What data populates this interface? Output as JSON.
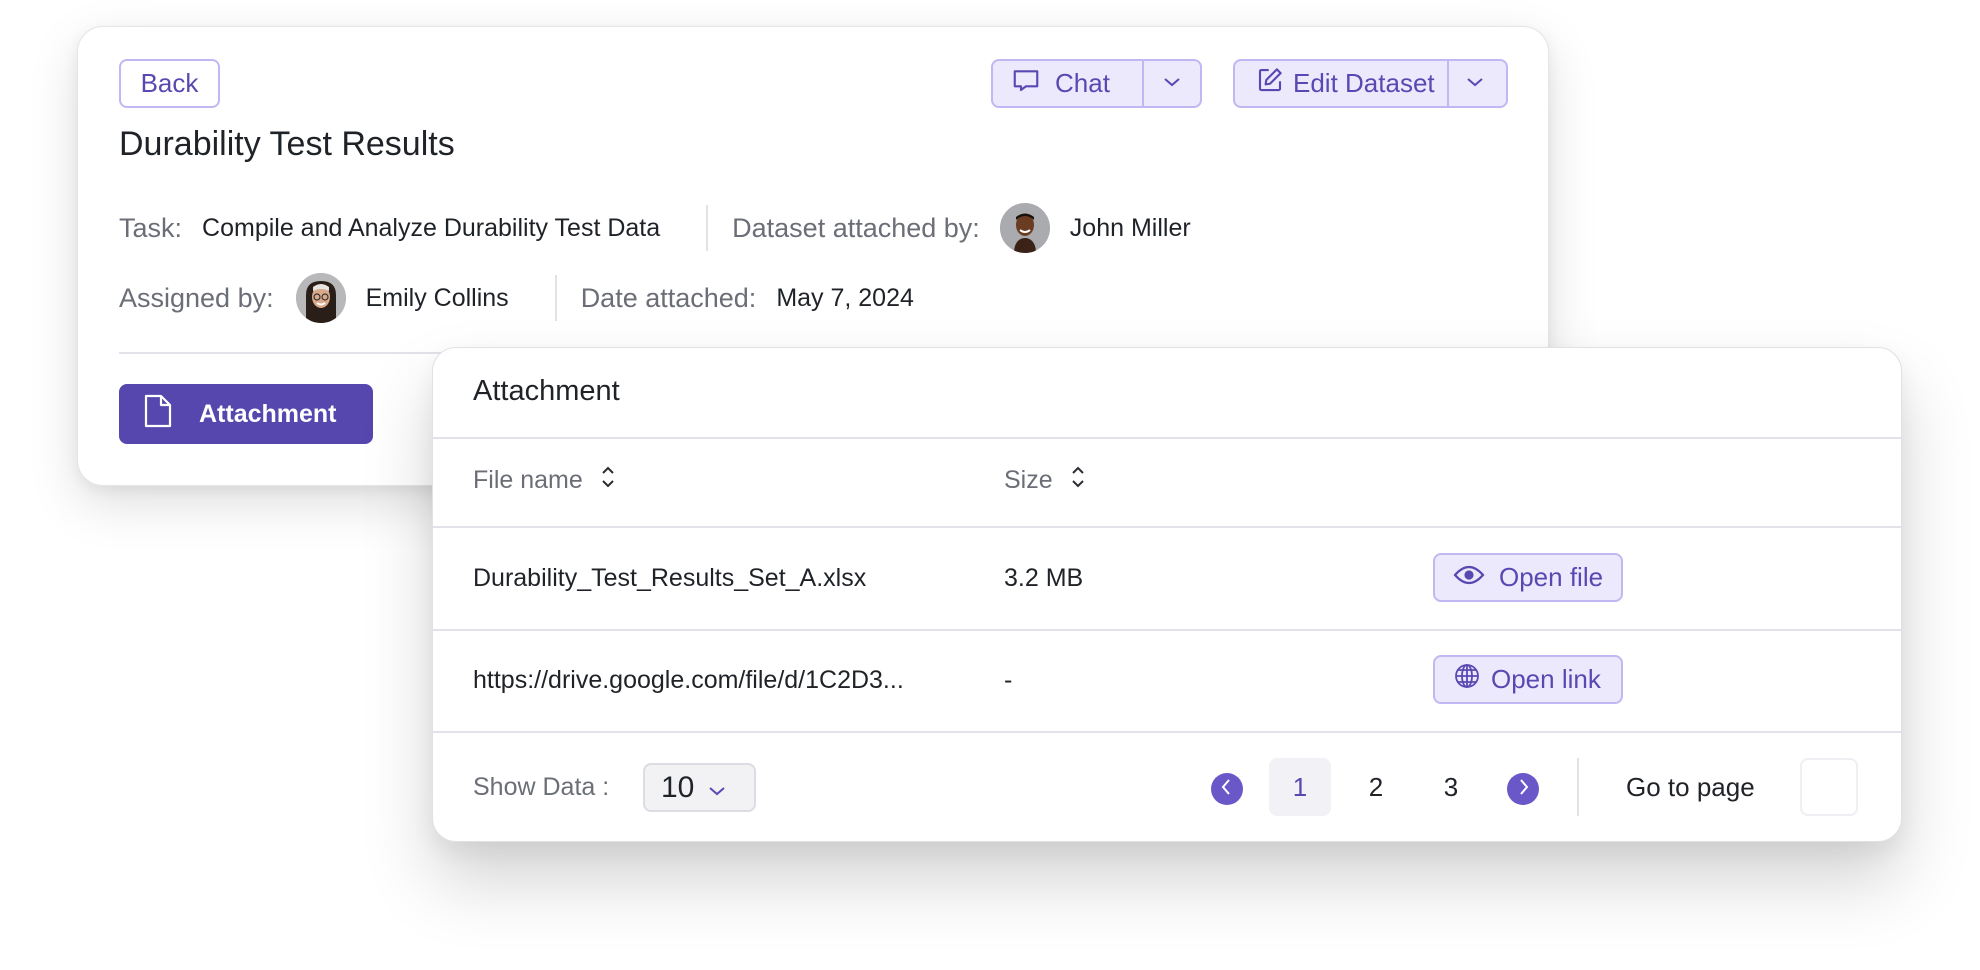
{
  "dataset": {
    "back_label": "Back",
    "title": "Durability Test Results",
    "chat_label": "Chat",
    "edit_label": "Edit Dataset",
    "task_label": "Task:",
    "task_value": "Compile and Analyze Durability Test Data",
    "attached_by_label": "Dataset attached by:",
    "attached_by_value": "John Miller",
    "assigned_by_label": "Assigned by:",
    "assigned_by_value": "Emily Collins",
    "date_label": "Date attached:",
    "date_value": "May 7, 2024",
    "attachment_tab_label": "Attachment"
  },
  "attachment_panel": {
    "title": "Attachment",
    "columns": [
      "File name",
      "Size"
    ],
    "rows": [
      {
        "name": "Durability_Test_Results_Set_A.xlsx",
        "size": "3.2 MB",
        "action": "Open file",
        "action_icon": "eye-icon"
      },
      {
        "name": "https://drive.google.com/file/d/1C2D3...",
        "size": "-",
        "action": "Open link",
        "action_icon": "globe-icon"
      }
    ],
    "footer": {
      "show_data_label": "Show Data :",
      "page_size": "10",
      "pages": [
        "1",
        "2",
        "3"
      ],
      "current_page": "1",
      "goto_label": "Go to page",
      "goto_value": ""
    }
  },
  "colors": {
    "accent": "#5547ad",
    "accent_light": "#ece9fd",
    "accent_border": "#c1b7f3"
  }
}
